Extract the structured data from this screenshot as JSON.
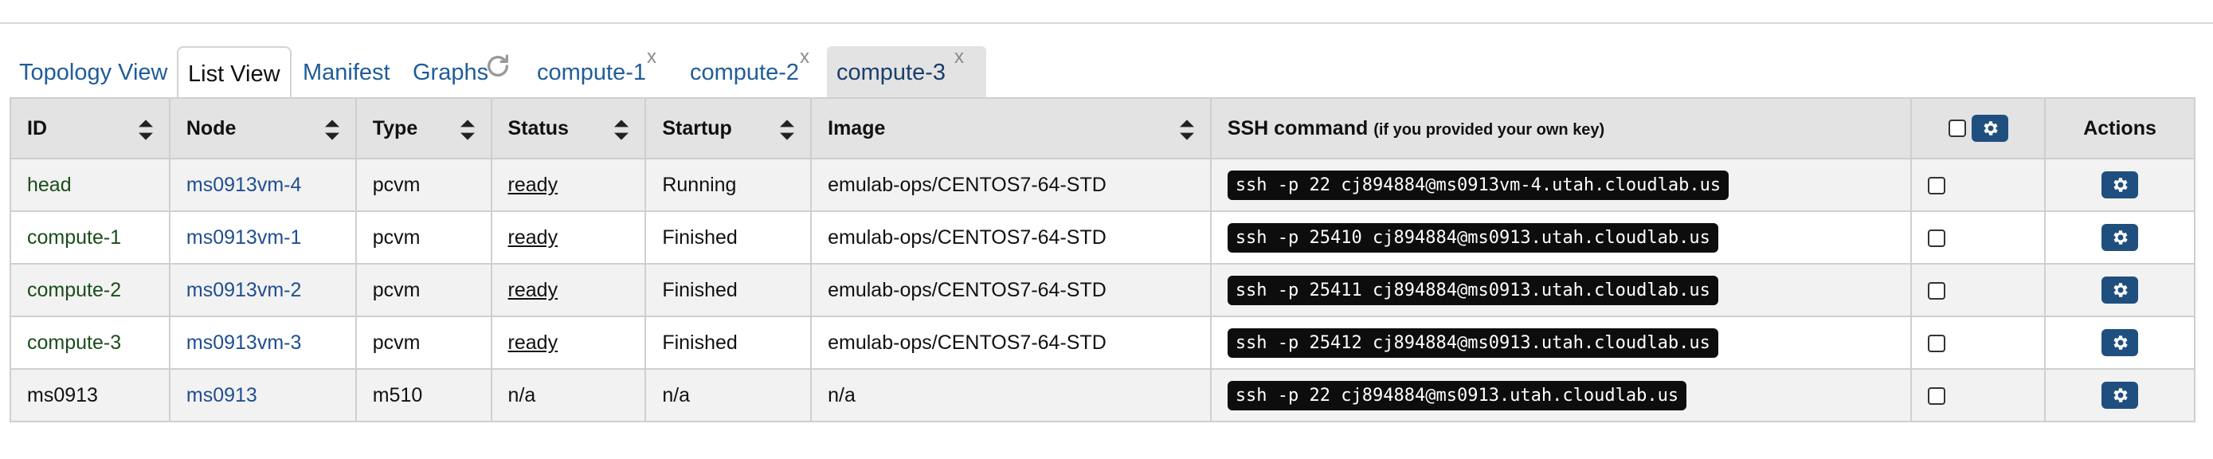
{
  "tabs": [
    {
      "label": "Topology View"
    },
    {
      "label": "List View"
    },
    {
      "label": "Manifest"
    },
    {
      "label": "Graphs"
    },
    {
      "label": "compute-1",
      "close": "x"
    },
    {
      "label": "compute-2",
      "close": "x"
    },
    {
      "label": "compute-3",
      "close": "x"
    }
  ],
  "table": {
    "headers": {
      "id": "ID",
      "node": "Node",
      "type": "Type",
      "status": "Status",
      "startup": "Startup",
      "image": "Image",
      "ssh_main": "SSH command ",
      "ssh_note": "(if you provided your own key)",
      "actions": "Actions"
    },
    "rows": [
      {
        "id": "head",
        "node": "ms0913vm-4",
        "type": "pcvm",
        "status": "ready",
        "startup": "Running",
        "image": "emulab-ops/CENTOS7-64-STD",
        "ssh": "ssh -p 22 cj894884@ms0913vm-4.utah.cloudlab.us"
      },
      {
        "id": "compute-1",
        "node": "ms0913vm-1",
        "type": "pcvm",
        "status": "ready",
        "startup": "Finished",
        "image": "emulab-ops/CENTOS7-64-STD",
        "ssh": "ssh -p 25410 cj894884@ms0913.utah.cloudlab.us"
      },
      {
        "id": "compute-2",
        "node": "ms0913vm-2",
        "type": "pcvm",
        "status": "ready",
        "startup": "Finished",
        "image": "emulab-ops/CENTOS7-64-STD",
        "ssh": "ssh -p 25411 cj894884@ms0913.utah.cloudlab.us"
      },
      {
        "id": "compute-3",
        "node": "ms0913vm-3",
        "type": "pcvm",
        "status": "ready",
        "startup": "Finished",
        "image": "emulab-ops/CENTOS7-64-STD",
        "ssh": "ssh -p 25412 cj894884@ms0913.utah.cloudlab.us"
      },
      {
        "id": "ms0913",
        "node": "ms0913",
        "type": "m510",
        "status": "n/a",
        "startup": "n/a",
        "image": "n/a",
        "ssh": "ssh -p 22 cj894884@ms0913.utah.cloudlab.us"
      }
    ]
  },
  "icons": {
    "refresh": "refresh-icon",
    "sort": "sort-icon",
    "gear": "gear-icon"
  },
  "colors": {
    "link": "#1f5d9a",
    "gear_button": "#1f4f7f",
    "header_bg": "#e3e3e3",
    "ssh_bg": "#0d0d0d"
  }
}
